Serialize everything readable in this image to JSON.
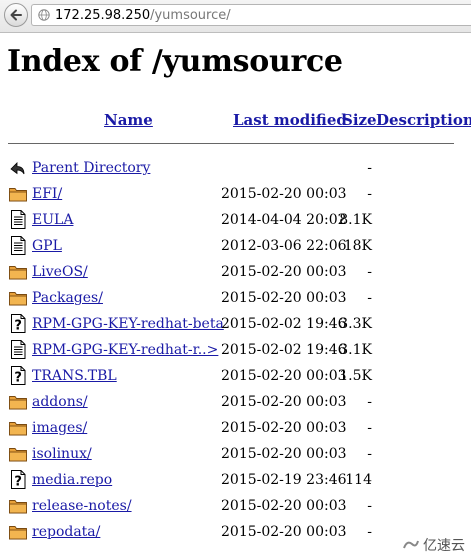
{
  "browser": {
    "url_host": "172.25.98.250",
    "url_path": "/yumsource/"
  },
  "page": {
    "title": "Index of /yumsource",
    "columns": {
      "name": "Name",
      "last_modified": "Last modified",
      "size": "Size",
      "description": "Description"
    }
  },
  "entries": [
    {
      "name": "Parent Directory",
      "date": "",
      "size": "-",
      "icon": "back-icon"
    },
    {
      "name": "EFI/",
      "date": "2015-02-20 00:03",
      "size": "-",
      "icon": "folder-icon"
    },
    {
      "name": "EULA",
      "date": "2014-04-04 20:02",
      "size": "8.1K",
      "icon": "text-file-icon"
    },
    {
      "name": "GPL",
      "date": "2012-03-06 22:06",
      "size": "18K",
      "icon": "text-file-icon"
    },
    {
      "name": "LiveOS/",
      "date": "2015-02-20 00:03",
      "size": "-",
      "icon": "folder-icon"
    },
    {
      "name": "Packages/",
      "date": "2015-02-20 00:03",
      "size": "-",
      "icon": "folder-icon"
    },
    {
      "name": "RPM-GPG-KEY-redhat-beta",
      "date": "2015-02-02 19:46",
      "size": "3.3K",
      "icon": "unknown-file-icon"
    },
    {
      "name": "RPM-GPG-KEY-redhat-r..>",
      "date": "2015-02-02 19:46",
      "size": "3.1K",
      "icon": "text-file-icon"
    },
    {
      "name": "TRANS.TBL",
      "date": "2015-02-20 00:03",
      "size": "1.5K",
      "icon": "unknown-file-icon"
    },
    {
      "name": "addons/",
      "date": "2015-02-20 00:03",
      "size": "-",
      "icon": "folder-icon"
    },
    {
      "name": "images/",
      "date": "2015-02-20 00:03",
      "size": "-",
      "icon": "folder-icon"
    },
    {
      "name": "isolinux/",
      "date": "2015-02-20 00:03",
      "size": "-",
      "icon": "folder-icon"
    },
    {
      "name": "media.repo",
      "date": "2015-02-19 23:46",
      "size": "114",
      "icon": "unknown-file-icon"
    },
    {
      "name": "release-notes/",
      "date": "2015-02-20 00:03",
      "size": "-",
      "icon": "folder-icon"
    },
    {
      "name": "repodata/",
      "date": "2015-02-20 00:03",
      "size": "-",
      "icon": "folder-icon"
    }
  ],
  "watermark": {
    "text": "亿速云"
  },
  "colors": {
    "link": "#1a1aa6",
    "folder": "#e8a13a"
  }
}
